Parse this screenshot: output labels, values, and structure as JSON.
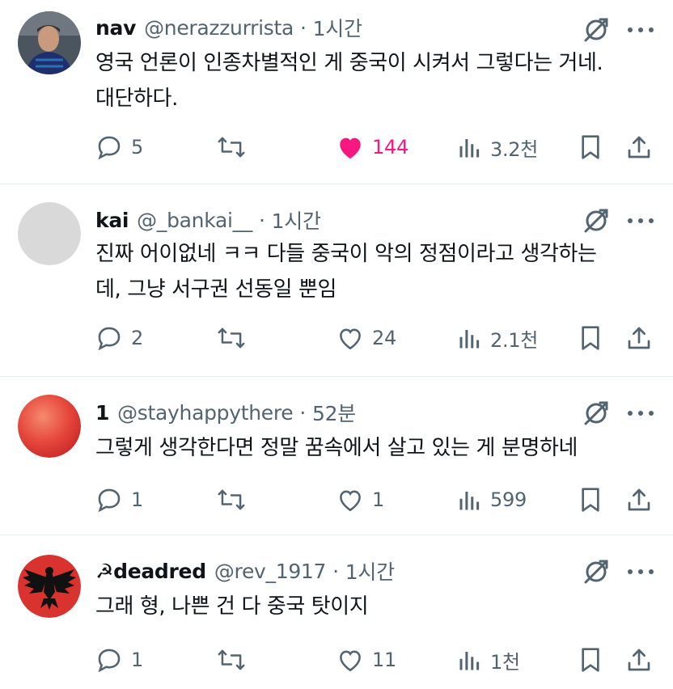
{
  "colors": {
    "text_primary": "#0f1419",
    "text_secondary": "#536471",
    "like_active": "#f91880",
    "divider": "#e6ecf0"
  },
  "posts": [
    {
      "display_name": "nav",
      "handle": "@nerazzurrista",
      "separator": "·",
      "time": "1시간",
      "text_lines": [
        "영국 언론이 인종차별적인 게 중국이 시켜서 그렇다는 거네.",
        "대단하다."
      ],
      "avatar": "photo-avatar",
      "replies": "5",
      "reposts": "",
      "likes": "144",
      "liked": true,
      "views": "3.2천"
    },
    {
      "display_name": "kai",
      "handle": "@_bankai__",
      "separator": "·",
      "time": "1시간",
      "text_lines": [
        "진짜 어이없네 ㅋㅋ 다들 중국이 악의 정점이라고 생각하는",
        "데, 그냥 서구권 선동일 뿐임"
      ],
      "avatar": "grey-avatar",
      "replies": "2",
      "reposts": "",
      "likes": "24",
      "liked": false,
      "views": "2.1천"
    },
    {
      "display_name": "1",
      "handle": "@stayhappythere",
      "separator": "·",
      "time": "52분",
      "text_lines": [
        "그렇게 생각한다면 정말 꿈속에서 살고 있는 게 분명하네"
      ],
      "avatar": "red-sphere-avatar",
      "replies": "1",
      "reposts": "",
      "likes": "1",
      "liked": false,
      "views": "599"
    },
    {
      "display_name": "☭deadred",
      "handle": "@rev_1917",
      "separator": "·",
      "time": "1시간",
      "text_lines": [
        "그래 형, 나쁜 건 다 중국 탓이지"
      ],
      "avatar": "eagle-avatar",
      "replies": "1",
      "reposts": "",
      "likes": "11",
      "liked": false,
      "views": "1천"
    }
  ],
  "icons": {
    "reply": "reply-icon",
    "repost": "repost-icon",
    "like": "heart-icon",
    "views": "views-icon",
    "bookmark": "bookmark-icon",
    "share": "share-icon",
    "grok": "grok-icon",
    "more": "more-icon"
  }
}
